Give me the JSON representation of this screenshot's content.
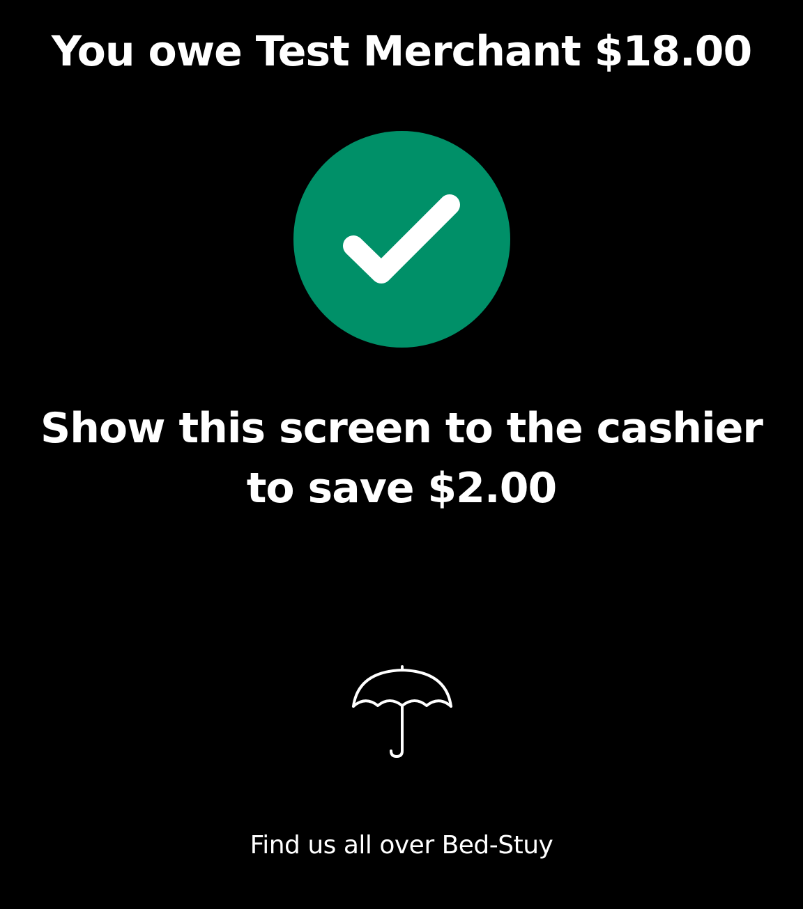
{
  "header": {
    "title": "You owe Test Merchant $18.00"
  },
  "status": {
    "icon": "check-circle-icon",
    "color": "#009068"
  },
  "message": {
    "line1": "Show this screen to the cashier",
    "line2": "to save $2.00"
  },
  "brand": {
    "icon": "umbrella-icon"
  },
  "footer": {
    "text": "Find us all over Bed-Stuy"
  },
  "theme": {
    "background": "#000000",
    "foreground": "#ffffff"
  }
}
